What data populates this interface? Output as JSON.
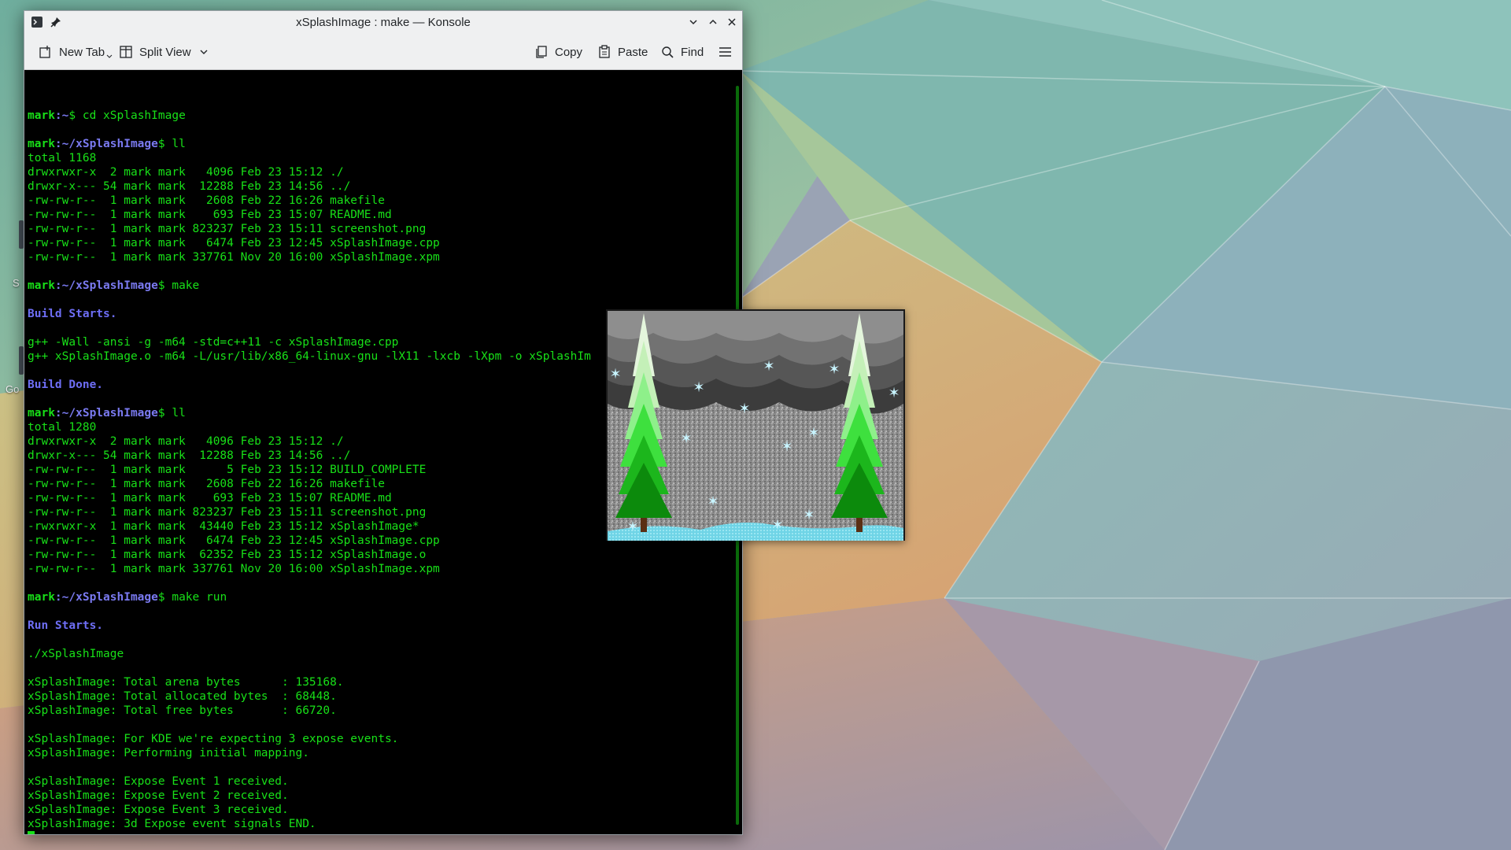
{
  "window": {
    "title": "xSplashImage : make — Konsole"
  },
  "toolbar": {
    "new_tab": "New Tab",
    "split_view": "Split View",
    "copy": "Copy",
    "paste": "Paste",
    "find": "Find"
  },
  "desktop": {
    "icon_label_1": "S",
    "icon_label_2": "Go"
  },
  "terminal": {
    "lines": [
      {
        "type": "blank",
        "text": ""
      },
      {
        "type": "prompt",
        "user": "mark",
        "path": ":~",
        "cmd": "$ cd xSplashImage"
      },
      {
        "type": "blank",
        "text": ""
      },
      {
        "type": "prompt",
        "user": "mark",
        "path": ":~/xSplashImage",
        "cmd": "$ ll"
      },
      {
        "type": "out",
        "text": "total 1168"
      },
      {
        "type": "out",
        "text": "drwxrwxr-x  2 mark mark   4096 Feb 23 15:12 ./"
      },
      {
        "type": "out",
        "text": "drwxr-x--- 54 mark mark  12288 Feb 23 14:56 ../"
      },
      {
        "type": "out",
        "text": "-rw-rw-r--  1 mark mark   2608 Feb 22 16:26 makefile"
      },
      {
        "type": "out",
        "text": "-rw-rw-r--  1 mark mark    693 Feb 23 15:07 README.md"
      },
      {
        "type": "out",
        "text": "-rw-rw-r--  1 mark mark 823237 Feb 23 15:11 screenshot.png"
      },
      {
        "type": "out",
        "text": "-rw-rw-r--  1 mark mark   6474 Feb 23 12:45 xSplashImage.cpp"
      },
      {
        "type": "out",
        "text": "-rw-rw-r--  1 mark mark 337761 Nov 20 16:00 xSplashImage.xpm"
      },
      {
        "type": "blank",
        "text": ""
      },
      {
        "type": "prompt",
        "user": "mark",
        "path": ":~/xSplashImage",
        "cmd": "$ make"
      },
      {
        "type": "blank",
        "text": ""
      },
      {
        "type": "msg",
        "text": "Build Starts."
      },
      {
        "type": "blank",
        "text": ""
      },
      {
        "type": "out",
        "text": "g++ -Wall -ansi -g -m64 -std=c++11 -c xSplashImage.cpp"
      },
      {
        "type": "out",
        "text": "g++ xSplashImage.o -m64 -L/usr/lib/x86_64-linux-gnu -lX11 -lxcb -lXpm -o xSplashIm"
      },
      {
        "type": "blank",
        "text": ""
      },
      {
        "type": "msg",
        "text": "Build Done."
      },
      {
        "type": "blank",
        "text": ""
      },
      {
        "type": "prompt",
        "user": "mark",
        "path": ":~/xSplashImage",
        "cmd": "$ ll"
      },
      {
        "type": "out",
        "text": "total 1280"
      },
      {
        "type": "out",
        "text": "drwxrwxr-x  2 mark mark   4096 Feb 23 15:12 ./"
      },
      {
        "type": "out",
        "text": "drwxr-x--- 54 mark mark  12288 Feb 23 14:56 ../"
      },
      {
        "type": "out",
        "text": "-rw-rw-r--  1 mark mark      5 Feb 23 15:12 BUILD_COMPLETE"
      },
      {
        "type": "out",
        "text": "-rw-rw-r--  1 mark mark   2608 Feb 22 16:26 makefile"
      },
      {
        "type": "out",
        "text": "-rw-rw-r--  1 mark mark    693 Feb 23 15:07 README.md"
      },
      {
        "type": "out",
        "text": "-rw-rw-r--  1 mark mark 823237 Feb 23 15:11 screenshot.png"
      },
      {
        "type": "out",
        "text": "-rwxrwxr-x  1 mark mark  43440 Feb 23 15:12 xSplashImage*"
      },
      {
        "type": "out",
        "text": "-rw-rw-r--  1 mark mark   6474 Feb 23 12:45 xSplashImage.cpp"
      },
      {
        "type": "out",
        "text": "-rw-rw-r--  1 mark mark  62352 Feb 23 15:12 xSplashImage.o"
      },
      {
        "type": "out",
        "text": "-rw-rw-r--  1 mark mark 337761 Nov 20 16:00 xSplashImage.xpm"
      },
      {
        "type": "blank",
        "text": ""
      },
      {
        "type": "prompt",
        "user": "mark",
        "path": ":~/xSplashImage",
        "cmd": "$ make run"
      },
      {
        "type": "blank",
        "text": ""
      },
      {
        "type": "msg",
        "text": "Run Starts."
      },
      {
        "type": "blank",
        "text": ""
      },
      {
        "type": "out",
        "text": "./xSplashImage"
      },
      {
        "type": "blank",
        "text": ""
      },
      {
        "type": "out",
        "text": "xSplashImage: Total arena bytes      : 135168."
      },
      {
        "type": "out",
        "text": "xSplashImage: Total allocated bytes  : 68448."
      },
      {
        "type": "out",
        "text": "xSplashImage: Total free bytes       : 66720."
      },
      {
        "type": "blank",
        "text": ""
      },
      {
        "type": "out",
        "text": "xSplashImage: For KDE we're expecting 3 expose events."
      },
      {
        "type": "out",
        "text": "xSplashImage: Performing initial mapping."
      },
      {
        "type": "blank",
        "text": ""
      },
      {
        "type": "out",
        "text": "xSplashImage: Expose Event 1 received."
      },
      {
        "type": "out",
        "text": "xSplashImage: Expose Event 2 received."
      },
      {
        "type": "out",
        "text": "xSplashImage: Expose Event 3 received."
      },
      {
        "type": "out",
        "text": "xSplashImage: 3d Expose event signals END."
      },
      {
        "type": "cursor",
        "text": ""
      }
    ]
  },
  "colors": {
    "terminal_fg": "#18e018",
    "prompt_path": "#7a7af0",
    "message": "#6e6ef5",
    "terminal_bg": "#000000"
  },
  "icons": {
    "app": "konsole-icon",
    "pin": "pin-icon",
    "minimize": "chevron-down-icon",
    "maximize": "chevron-up-icon",
    "close": "close-icon",
    "new_tab": "new-tab-icon",
    "split_view": "split-view-icon",
    "copy": "copy-icon",
    "paste": "paste-icon",
    "find": "search-icon",
    "menu": "hamburger-menu-icon"
  }
}
